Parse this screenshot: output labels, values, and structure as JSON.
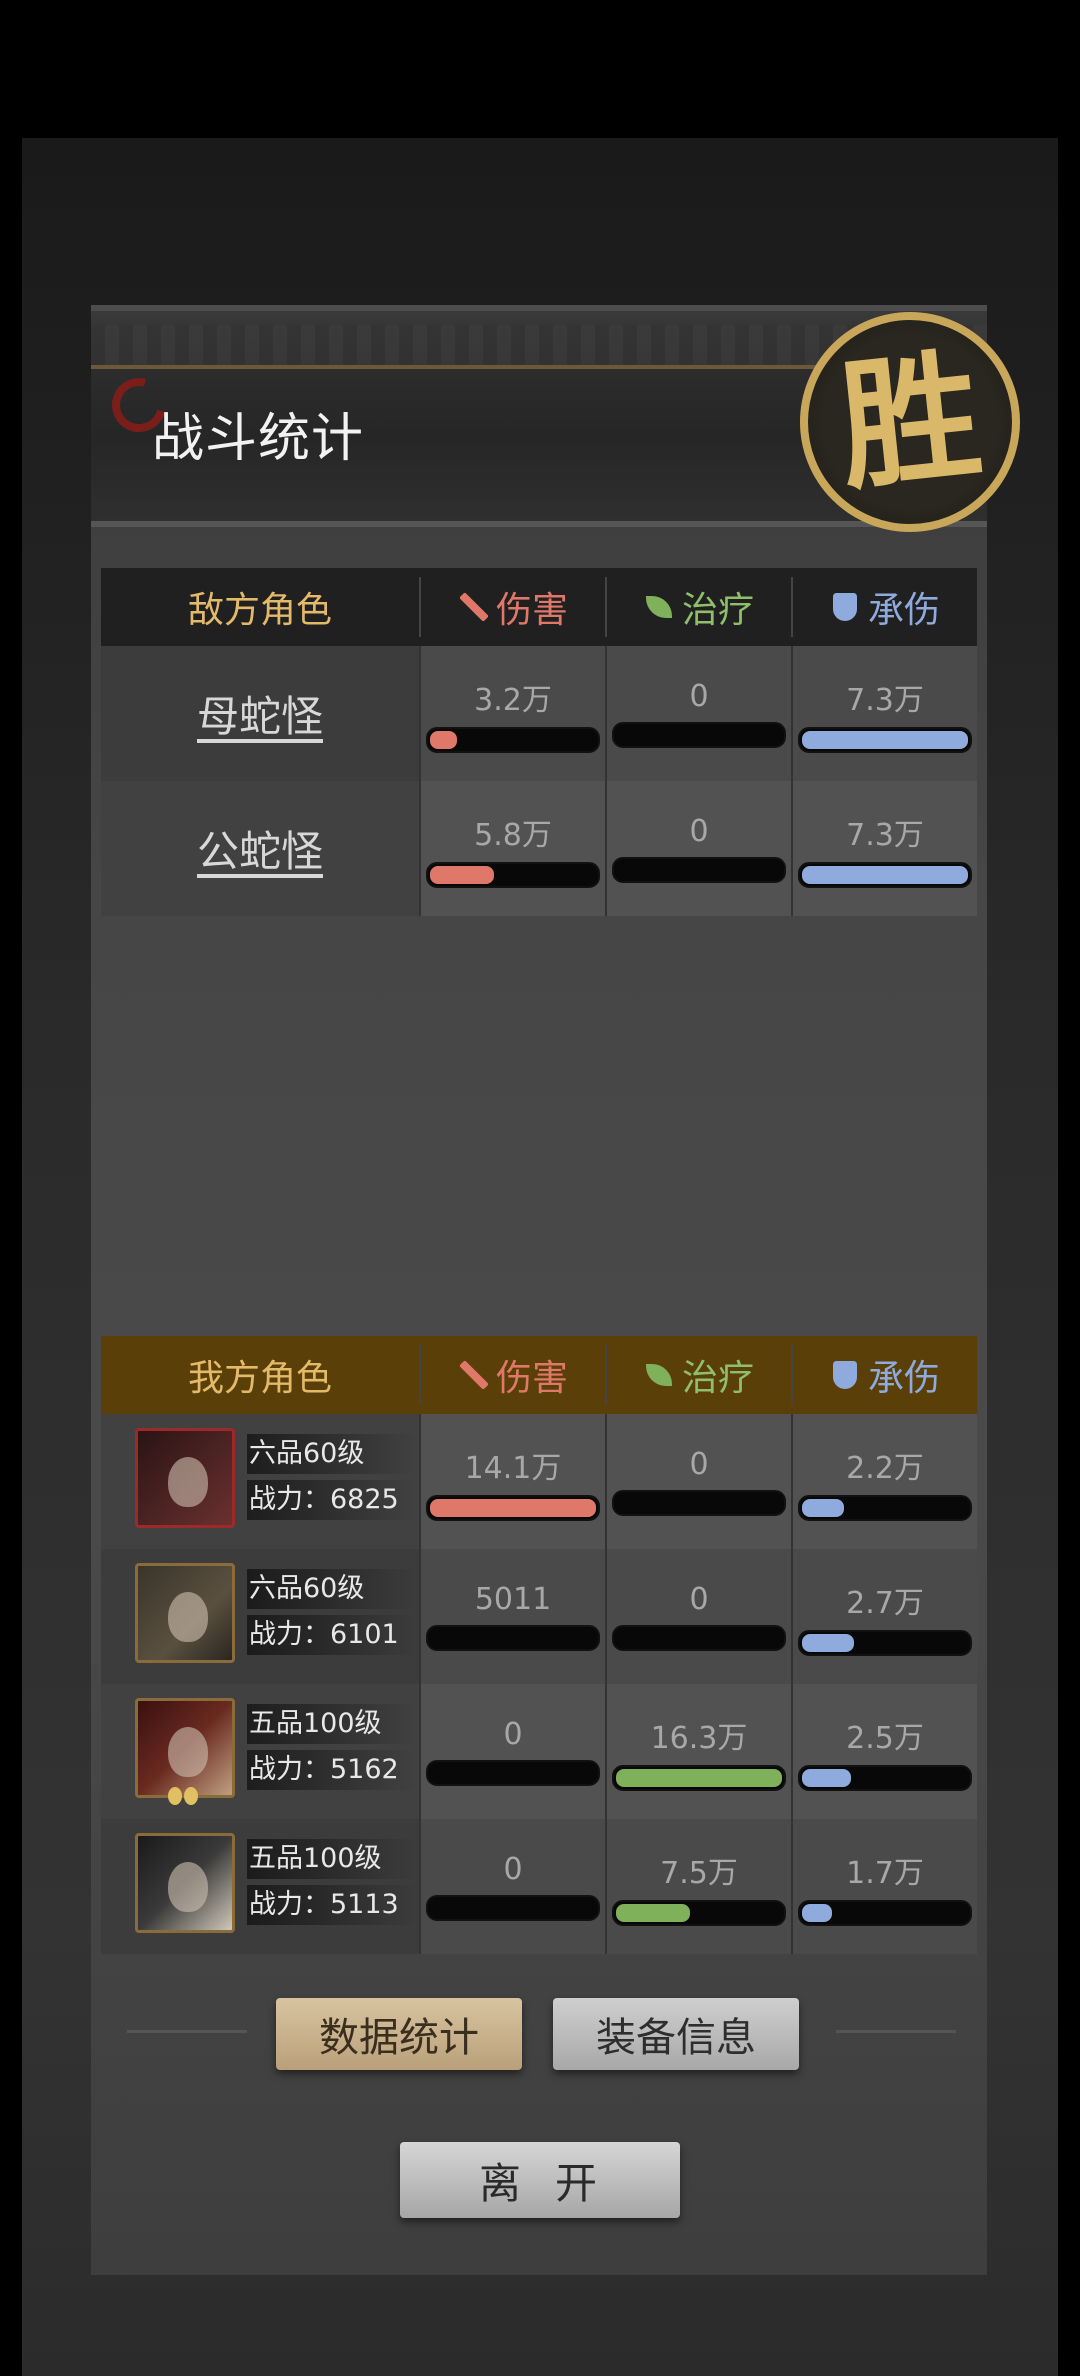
{
  "header": {
    "title": "战斗统计",
    "seal": "胜"
  },
  "columns": {
    "damage": "伤害",
    "heal": "治疗",
    "taken": "承伤"
  },
  "enemy": {
    "header": "敌方角色",
    "rows": [
      {
        "name": "母蛇怪",
        "damage": "3.2万",
        "damage_frac": 0.18,
        "heal": "0",
        "heal_frac": 0,
        "taken": "7.3万",
        "taken_frac": 1.0
      },
      {
        "name": "公蛇怪",
        "damage": "5.8万",
        "damage_frac": 0.4,
        "heal": "0",
        "heal_frac": 0,
        "taken": "7.3万",
        "taken_frac": 1.0
      }
    ]
  },
  "ally": {
    "header": "我方角色",
    "rows": [
      {
        "level": "六品60级",
        "power_label": "战力：",
        "power": "6825",
        "damage": "14.1万",
        "damage_frac": 1.0,
        "heal": "0",
        "heal_frac": 0,
        "taken": "2.2万",
        "taken_frac": 0.27
      },
      {
        "level": "六品60级",
        "power_label": "战力：",
        "power": "6101",
        "damage": "5011",
        "damage_frac": 0,
        "heal": "0",
        "heal_frac": 0,
        "taken": "2.7万",
        "taken_frac": 0.33
      },
      {
        "level": "五品100级",
        "power_label": "战力：",
        "power": "5162",
        "damage": "0",
        "damage_frac": 0,
        "heal": "16.3万",
        "heal_frac": 1.0,
        "taken": "2.5万",
        "taken_frac": 0.31
      },
      {
        "level": "五品100级",
        "power_label": "战力：",
        "power": "5113",
        "damage": "0",
        "damage_frac": 0,
        "heal": "7.5万",
        "heal_frac": 0.46,
        "taken": "1.7万",
        "taken_frac": 0.2
      }
    ]
  },
  "tabs": {
    "stats": "数据统计",
    "equipment": "装备信息"
  },
  "leave": "离开"
}
